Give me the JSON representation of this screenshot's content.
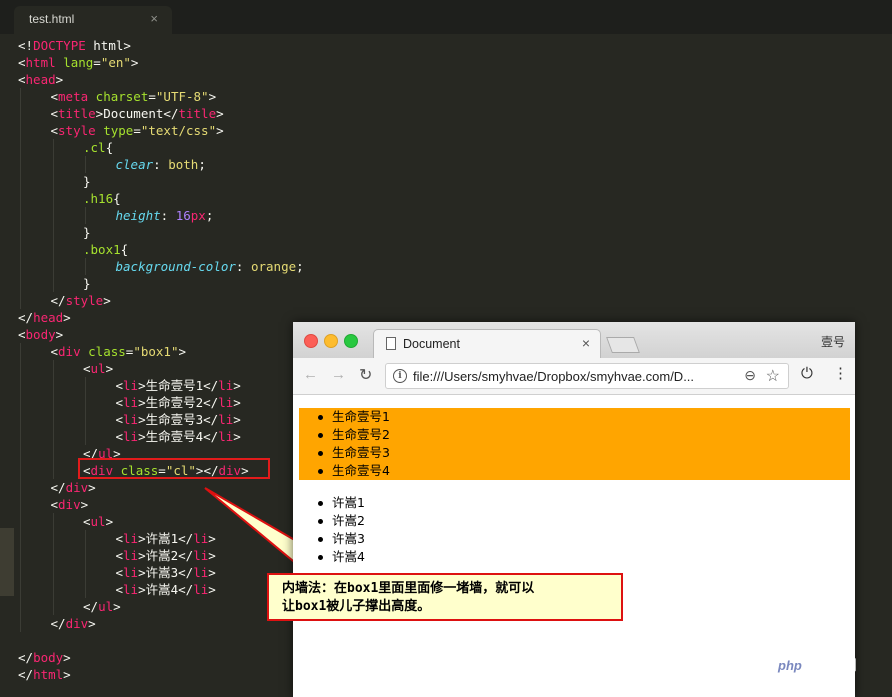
{
  "editor": {
    "tab_title": "test.html",
    "tab_close": "×"
  },
  "code_lines": [
    {
      "indent": 0,
      "tokens": [
        [
          "t",
          "<!"
        ],
        [
          "tag",
          "DOCTYPE"
        ],
        [
          "t",
          " html>"
        ]
      ]
    },
    {
      "indent": 0,
      "tokens": [
        [
          "t",
          "<"
        ],
        [
          "tag",
          "html"
        ],
        [
          "t",
          " "
        ],
        [
          "attr",
          "lang"
        ],
        [
          "t",
          "="
        ],
        [
          "str",
          "\"en\""
        ],
        [
          "t",
          ">"
        ]
      ]
    },
    {
      "indent": 0,
      "tokens": [
        [
          "t",
          "<"
        ],
        [
          "tag",
          "head"
        ],
        [
          "t",
          ">"
        ]
      ]
    },
    {
      "indent": 1,
      "tokens": [
        [
          "t",
          "<"
        ],
        [
          "tag",
          "meta"
        ],
        [
          "t",
          " "
        ],
        [
          "attr",
          "charset"
        ],
        [
          "t",
          "="
        ],
        [
          "str",
          "\"UTF-8\""
        ],
        [
          "t",
          ">"
        ]
      ]
    },
    {
      "indent": 1,
      "tokens": [
        [
          "t",
          "<"
        ],
        [
          "tag",
          "title"
        ],
        [
          "t",
          ">Document</"
        ],
        [
          "tag",
          "title"
        ],
        [
          "t",
          ">"
        ]
      ]
    },
    {
      "indent": 1,
      "tokens": [
        [
          "t",
          "<"
        ],
        [
          "tag",
          "style"
        ],
        [
          "t",
          " "
        ],
        [
          "attr",
          "type"
        ],
        [
          "t",
          "="
        ],
        [
          "str",
          "\"text/css\""
        ],
        [
          "t",
          ">"
        ]
      ]
    },
    {
      "indent": 2,
      "tokens": [
        [
          "attr",
          ".cl"
        ],
        [
          "t",
          "{"
        ]
      ]
    },
    {
      "indent": 3,
      "tokens": [
        [
          "prop",
          "clear"
        ],
        [
          "t",
          ": "
        ],
        [
          "str",
          "both"
        ],
        [
          "t",
          ";"
        ]
      ]
    },
    {
      "indent": 2,
      "tokens": [
        [
          "t",
          "}"
        ]
      ]
    },
    {
      "indent": 2,
      "tokens": [
        [
          "attr",
          ".h16"
        ],
        [
          "t",
          "{"
        ]
      ]
    },
    {
      "indent": 3,
      "tokens": [
        [
          "prop",
          "height"
        ],
        [
          "t",
          ": "
        ],
        [
          "num",
          "16"
        ],
        [
          "tag",
          "px"
        ],
        [
          "t",
          ";"
        ]
      ]
    },
    {
      "indent": 2,
      "tokens": [
        [
          "t",
          "}"
        ]
      ]
    },
    {
      "indent": 2,
      "tokens": [
        [
          "attr",
          ".box1"
        ],
        [
          "t",
          "{"
        ]
      ]
    },
    {
      "indent": 3,
      "tokens": [
        [
          "prop",
          "background-color"
        ],
        [
          "t",
          ": "
        ],
        [
          "str",
          "orange"
        ],
        [
          "t",
          ";"
        ]
      ]
    },
    {
      "indent": 2,
      "tokens": [
        [
          "t",
          "}"
        ]
      ]
    },
    {
      "indent": 1,
      "tokens": [
        [
          "t",
          "</"
        ],
        [
          "tag",
          "style"
        ],
        [
          "t",
          ">"
        ]
      ]
    },
    {
      "indent": 0,
      "tokens": [
        [
          "t",
          "</"
        ],
        [
          "tag",
          "head"
        ],
        [
          "t",
          ">"
        ]
      ]
    },
    {
      "indent": 0,
      "tokens": [
        [
          "t",
          "<"
        ],
        [
          "tag",
          "body"
        ],
        [
          "t",
          ">"
        ]
      ]
    },
    {
      "indent": 1,
      "tokens": [
        [
          "t",
          "<"
        ],
        [
          "tag",
          "div"
        ],
        [
          "t",
          " "
        ],
        [
          "attr",
          "class"
        ],
        [
          "t",
          "="
        ],
        [
          "str",
          "\"box1\""
        ],
        [
          "t",
          ">"
        ]
      ]
    },
    {
      "indent": 2,
      "tokens": [
        [
          "t",
          "<"
        ],
        [
          "tag",
          "ul"
        ],
        [
          "t",
          ">"
        ]
      ]
    },
    {
      "indent": 3,
      "tokens": [
        [
          "t",
          "<"
        ],
        [
          "tag",
          "li"
        ],
        [
          "t",
          ">生命壹号1</"
        ],
        [
          "tag",
          "li"
        ],
        [
          "t",
          ">"
        ]
      ]
    },
    {
      "indent": 3,
      "tokens": [
        [
          "t",
          "<"
        ],
        [
          "tag",
          "li"
        ],
        [
          "t",
          ">生命壹号2</"
        ],
        [
          "tag",
          "li"
        ],
        [
          "t",
          ">"
        ]
      ]
    },
    {
      "indent": 3,
      "tokens": [
        [
          "t",
          "<"
        ],
        [
          "tag",
          "li"
        ],
        [
          "t",
          ">生命壹号3</"
        ],
        [
          "tag",
          "li"
        ],
        [
          "t",
          ">"
        ]
      ]
    },
    {
      "indent": 3,
      "tokens": [
        [
          "t",
          "<"
        ],
        [
          "tag",
          "li"
        ],
        [
          "t",
          ">生命壹号4</"
        ],
        [
          "tag",
          "li"
        ],
        [
          "t",
          ">"
        ]
      ]
    },
    {
      "indent": 2,
      "tokens": [
        [
          "t",
          "</"
        ],
        [
          "tag",
          "ul"
        ],
        [
          "t",
          ">"
        ]
      ]
    },
    {
      "indent": 2,
      "tokens": [
        [
          "t",
          "<"
        ],
        [
          "tag",
          "div"
        ],
        [
          "t",
          " "
        ],
        [
          "attr",
          "class"
        ],
        [
          "t",
          "="
        ],
        [
          "str",
          "\"cl\""
        ],
        [
          "t",
          "></"
        ],
        [
          "tag",
          "div"
        ],
        [
          "t",
          ">"
        ]
      ]
    },
    {
      "indent": 1,
      "tokens": [
        [
          "t",
          "</"
        ],
        [
          "tag",
          "div"
        ],
        [
          "t",
          ">"
        ]
      ]
    },
    {
      "indent": 1,
      "tokens": [
        [
          "t",
          "<"
        ],
        [
          "tag",
          "div"
        ],
        [
          "t",
          ">"
        ]
      ]
    },
    {
      "indent": 2,
      "tokens": [
        [
          "t",
          "<"
        ],
        [
          "tag",
          "ul"
        ],
        [
          "t",
          ">"
        ]
      ]
    },
    {
      "indent": 3,
      "tokens": [
        [
          "t",
          "<"
        ],
        [
          "tag",
          "li"
        ],
        [
          "t",
          ">许嵩1</"
        ],
        [
          "tag",
          "li"
        ],
        [
          "t",
          ">"
        ]
      ]
    },
    {
      "indent": 3,
      "tokens": [
        [
          "t",
          "<"
        ],
        [
          "tag",
          "li"
        ],
        [
          "t",
          ">许嵩2</"
        ],
        [
          "tag",
          "li"
        ],
        [
          "t",
          ">"
        ]
      ]
    },
    {
      "indent": 3,
      "tokens": [
        [
          "t",
          "<"
        ],
        [
          "tag",
          "li"
        ],
        [
          "t",
          ">许嵩3</"
        ],
        [
          "tag",
          "li"
        ],
        [
          "t",
          ">"
        ]
      ]
    },
    {
      "indent": 3,
      "tokens": [
        [
          "t",
          "<"
        ],
        [
          "tag",
          "li"
        ],
        [
          "t",
          ">许嵩4</"
        ],
        [
          "tag",
          "li"
        ],
        [
          "t",
          ">"
        ]
      ]
    },
    {
      "indent": 2,
      "tokens": [
        [
          "t",
          "</"
        ],
        [
          "tag",
          "ul"
        ],
        [
          "t",
          ">"
        ]
      ]
    },
    {
      "indent": 1,
      "tokens": [
        [
          "t",
          "</"
        ],
        [
          "tag",
          "div"
        ],
        [
          "t",
          ">"
        ]
      ]
    },
    {
      "indent": 0,
      "tokens": []
    },
    {
      "indent": 0,
      "tokens": [
        [
          "t",
          "</"
        ],
        [
          "tag",
          "body"
        ],
        [
          "t",
          ">"
        ]
      ]
    },
    {
      "indent": 0,
      "tokens": [
        [
          "t",
          "</"
        ],
        [
          "tag",
          "html"
        ],
        [
          "t",
          ">"
        ]
      ]
    }
  ],
  "browser": {
    "tab_title": "Document",
    "tab_close": "×",
    "profile": "壹号",
    "url": "file:///Users/smyhvae/Dropbox/smyhvae.com/D...",
    "box1_items": [
      "生命壹号1",
      "生命壹号2",
      "生命壹号3",
      "生命壹号4"
    ],
    "list2_items": [
      "许嵩1",
      "许嵩2",
      "许嵩3",
      "许嵩4"
    ]
  },
  "callout": {
    "line1": "内墙法：在box1里面里面修一堵墙，就可以",
    "line2": "让box1被儿子撑出高度。"
  },
  "watermark": {
    "logo": "php",
    "text": "中文网"
  },
  "colors": {
    "editor_bg": "#272822",
    "tag": "#f92672",
    "attr": "#a6e22e",
    "string": "#e6db74",
    "property": "#66d9ef",
    "number": "#ae81ff",
    "box1_bg": "#ffa500",
    "highlight": "#e21b1b",
    "callout_bg": "#ffffcc"
  }
}
